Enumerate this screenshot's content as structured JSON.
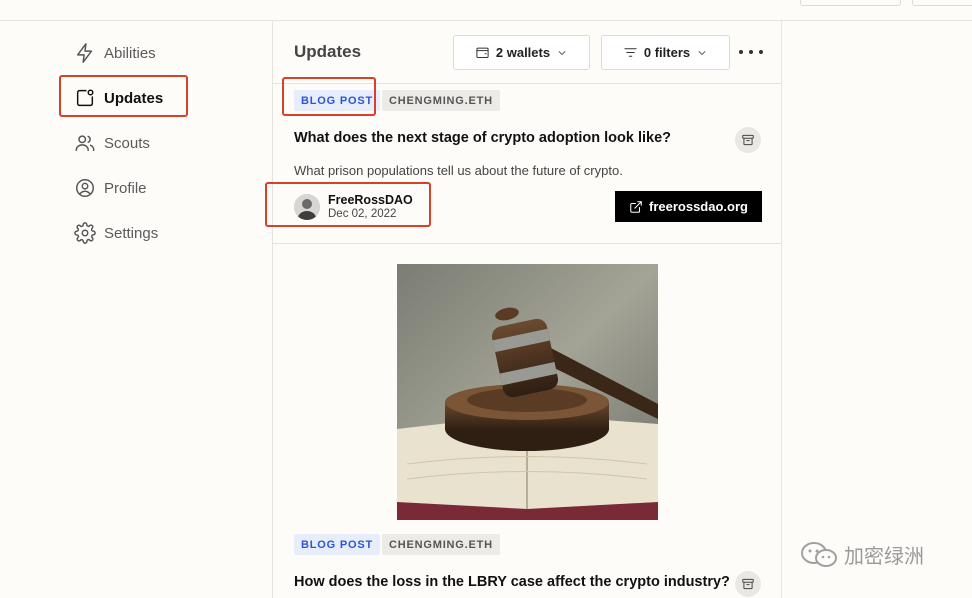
{
  "sidebar": {
    "items": [
      {
        "label": "Abilities",
        "icon": "lightning-icon"
      },
      {
        "label": "Updates",
        "icon": "notification-square-icon",
        "active": true
      },
      {
        "label": "Scouts",
        "icon": "users-icon"
      },
      {
        "label": "Profile",
        "icon": "user-circle-icon"
      },
      {
        "label": "Settings",
        "icon": "gear-icon"
      }
    ]
  },
  "main": {
    "title": "Updates",
    "wallets_label": "2 wallets",
    "filters_label": "0 filters"
  },
  "posts": [
    {
      "tag": "BLOG POST",
      "source": "CHENGMING.ETH",
      "title": "What does the next stage of crypto adoption look like?",
      "description": "What prison populations tell us about the future of crypto.",
      "author": "FreeRossDAO",
      "date": "Dec 02, 2022",
      "link": "freerossdao.org"
    },
    {
      "tag": "BLOG POST",
      "source": "CHENGMING.ETH",
      "title": "How does the loss in the LBRY case affect the crypto industry?"
    }
  ],
  "watermark": "加密绿洲",
  "colors": {
    "highlight": "#d9402b",
    "tag_blue": "#2a55d6",
    "link_button": "#000000"
  }
}
